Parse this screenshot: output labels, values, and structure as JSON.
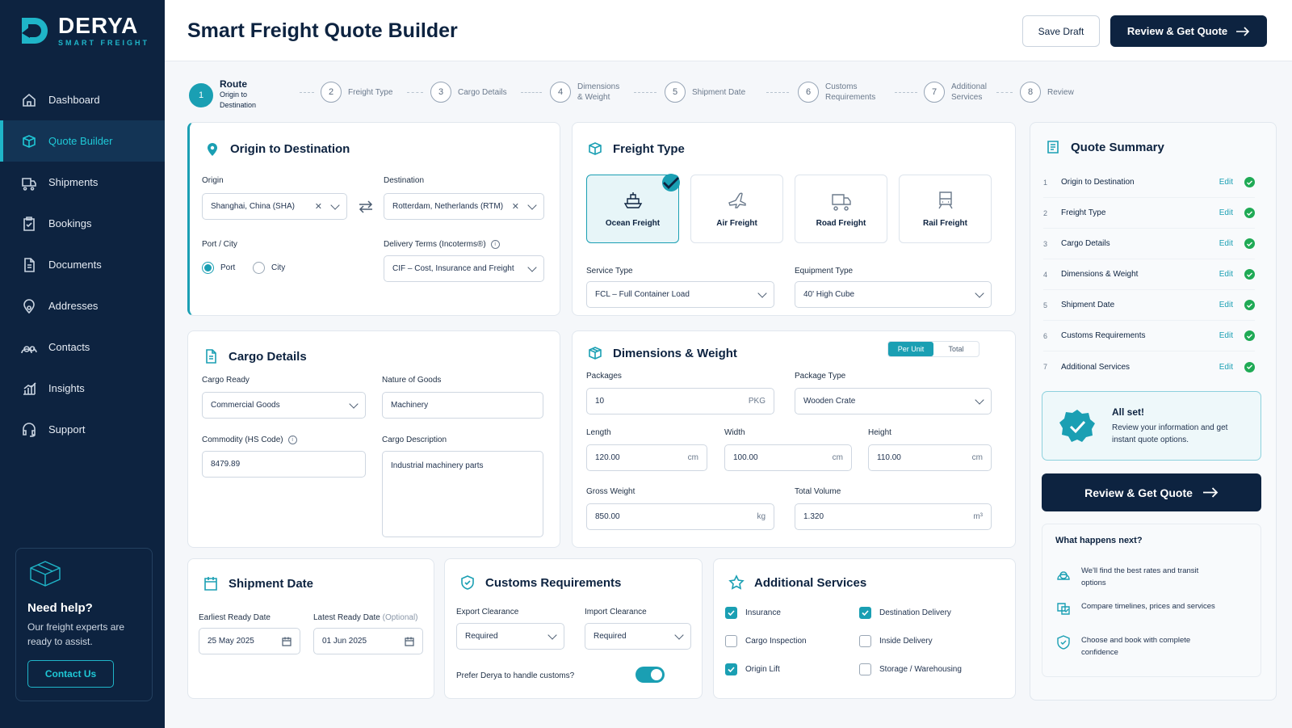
{
  "app": {
    "brand": "DERYA",
    "tagline": "SMART FREIGHT"
  },
  "sidebar": {
    "items": [
      {
        "label": "Dashboard"
      },
      {
        "label": "Quote Builder"
      },
      {
        "label": "Shipments"
      },
      {
        "label": "Bookings"
      },
      {
        "label": "Documents"
      },
      {
        "label": "Addresses"
      },
      {
        "label": "Contacts"
      },
      {
        "label": "Insights"
      },
      {
        "label": "Support"
      }
    ],
    "help": {
      "title": "Need help?",
      "text": "Our freight experts are ready to assist.",
      "button": "Contact Us"
    }
  },
  "header": {
    "title": "Smart Freight Quote Builder",
    "save_label": "Save Draft",
    "review_label": "Review & Get Quote"
  },
  "steps": [
    {
      "num": "1",
      "label": "Route",
      "sub": "Origin to Destination"
    },
    {
      "num": "2",
      "label": "Freight Type"
    },
    {
      "num": "3",
      "label": "Cargo Details"
    },
    {
      "num": "4",
      "label": "Dimensions & Weight"
    },
    {
      "num": "5",
      "label": "Shipment Date"
    },
    {
      "num": "6",
      "label": "Customs Requirements"
    },
    {
      "num": "7",
      "label": "Additional Services"
    },
    {
      "num": "8",
      "label": "Review"
    }
  ],
  "route": {
    "title": "Origin to Destination",
    "origin_label": "Origin",
    "origin_value": "Shanghai, China (SHA)",
    "destination_label": "Destination",
    "destination_value": "Rotterdam, Netherlands (RTM)",
    "portcity_label": "Port / City",
    "port_option": "Port",
    "city_option": "City",
    "incoterms_label": "Delivery Terms (Incoterms®)",
    "incoterms_value": "CIF – Cost, Insurance and Freight"
  },
  "freight": {
    "title": "Freight Type",
    "options": [
      {
        "label": "Ocean Freight"
      },
      {
        "label": "Air Freight"
      },
      {
        "label": "Road Freight"
      },
      {
        "label": "Rail Freight"
      }
    ],
    "service_label": "Service Type",
    "service_value": "FCL – Full Container Load",
    "equipment_label": "Equipment Type",
    "equipment_value": "40' High Cube"
  },
  "cargo": {
    "title": "Cargo Details",
    "ready_label": "Cargo Ready",
    "ready_value": "Commercial Goods",
    "nature_label": "Nature of Goods",
    "nature_value": "Machinery",
    "hs_label": "Commodity (HS Code)",
    "hs_value": "8479.89",
    "desc_label": "Cargo Description",
    "desc_value": "Industrial machinery parts"
  },
  "dims": {
    "title": "Dimensions & Weight",
    "toggle_per_unit": "Per Unit",
    "toggle_total": "Total",
    "packages_label": "Packages",
    "packages_value": "10",
    "packages_unit": "PKG",
    "package_type_label": "Package Type",
    "package_type_value": "Wooden Crate",
    "length_label": "Length",
    "length_value": "120.00",
    "length_unit": "cm",
    "width_label": "Width",
    "width_value": "100.00",
    "width_unit": "cm",
    "height_label": "Height",
    "height_value": "110.00",
    "height_unit": "cm",
    "gross_label": "Gross Weight",
    "gross_value": "850.00",
    "gross_unit": "kg",
    "volume_label": "Total Volume",
    "volume_value": "1.320",
    "volume_unit": "m³"
  },
  "shipdate": {
    "title": "Shipment Date",
    "earliest_label": "Earliest Ready Date",
    "earliest_value": "25 May 2025",
    "latest_label": "Latest Ready Date",
    "latest_optional": "(Optional)",
    "latest_value": "01 Jun 2025"
  },
  "customs": {
    "title": "Customs Requirements",
    "export_label": "Export Clearance",
    "export_value": "Required",
    "import_label": "Import Clearance",
    "import_value": "Required",
    "prefer_label": "Prefer Derya to handle customs?"
  },
  "services": {
    "title": "Additional Services",
    "items": [
      {
        "label": "Insurance",
        "checked": true
      },
      {
        "label": "Destination Delivery",
        "checked": true
      },
      {
        "label": "Cargo Inspection",
        "checked": false
      },
      {
        "label": "Inside Delivery",
        "checked": false
      },
      {
        "label": "Origin Lift",
        "checked": true
      },
      {
        "label": "Storage / Warehousing",
        "checked": false
      }
    ]
  },
  "summary": {
    "title": "Quote Summary",
    "edit_label": "Edit",
    "rows": [
      {
        "num": "1",
        "label": "Origin to Destination"
      },
      {
        "num": "2",
        "label": "Freight Type"
      },
      {
        "num": "3",
        "label": "Cargo Details"
      },
      {
        "num": "4",
        "label": "Dimensions & Weight"
      },
      {
        "num": "5",
        "label": "Shipment Date"
      },
      {
        "num": "6",
        "label": "Customs Requirements"
      },
      {
        "num": "7",
        "label": "Additional Services"
      }
    ],
    "allset_title": "All set!",
    "allset_text": "Review your information and get instant quote options.",
    "button": "Review & Get Quote",
    "next_title": "What happens next?",
    "next_items": [
      {
        "text": "We'll find the best rates and transit options"
      },
      {
        "text": "Compare timelines, prices and services"
      },
      {
        "text": "Choose and book with complete confidence"
      }
    ]
  },
  "colors": {
    "navy": "#0d2340",
    "accent": "#1a9fb3",
    "success": "#1faa55"
  }
}
